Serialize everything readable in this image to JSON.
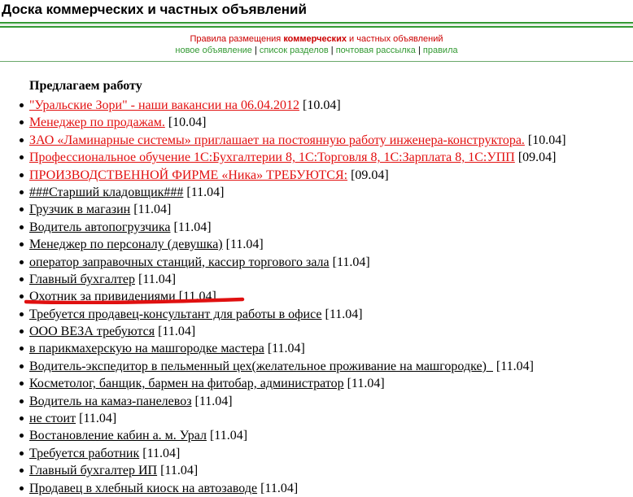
{
  "page": {
    "site_title": "Доска коммерческих и частных объявлений"
  },
  "header": {
    "rules_prefix": "Правила размещения",
    "rules_commercial": "коммерческих",
    "rules_and_private": "и частных объявлений",
    "nav": [
      {
        "label": "новое объявление"
      },
      {
        "label": "список разделов"
      },
      {
        "label": "почтовая рассылка"
      },
      {
        "label": "правила"
      }
    ],
    "separator": " | "
  },
  "section": {
    "heading": "Предлагаем работу"
  },
  "ads": [
    {
      "title": "\"Уральские Зори\" - наши вакансии на 06.04.2012",
      "date": "[10.04]",
      "highlight": true
    },
    {
      "title": "Менеджер по продажам.",
      "date": "[10.04]",
      "highlight": true
    },
    {
      "title": "ЗАО «Ламинарные системы» приглашает на постоянную работу инженера-конструктора.",
      "date": "[10.04]",
      "highlight": true
    },
    {
      "title": "Профессиональное обучение 1С:Бухгалтерии 8, 1С:Торговля 8, 1С:Зарплата 8, 1С:УПП",
      "date": "[09.04]",
      "highlight": true
    },
    {
      "title": "ПРОИЗВОДСТВЕННОЙ ФИРМЕ «Ника» ТРЕБУЮТСЯ:",
      "date": "[09.04]",
      "highlight": true
    },
    {
      "title": "###Старший кладовщик###",
      "date": "[11.04]",
      "highlight": false
    },
    {
      "title": "Грузчик в магазин",
      "date": "[11.04]",
      "highlight": false
    },
    {
      "title": "Водитель автопогрузчика",
      "date": "[11.04]",
      "highlight": false
    },
    {
      "title": "Менеджер по персоналу (девушка)",
      "date": "[11.04]",
      "highlight": false
    },
    {
      "title": "оператор заправочных станций, кассир торгового зала",
      "date": "[11.04]",
      "highlight": false
    },
    {
      "title": "Главный бухгалтер",
      "date": "[11.04]",
      "highlight": false
    },
    {
      "title": "Охотник за привидениями",
      "date": "[11.04]",
      "highlight": false
    },
    {
      "title": "Требуется продавец-консультант для работы в офисе",
      "date": "[11.04]",
      "highlight": false
    },
    {
      "title": "ООО ВЕЗА требуются",
      "date": "[11.04]",
      "highlight": false
    },
    {
      "title": "в парикмахерскую на машгородке мастера",
      "date": "[11.04]",
      "highlight": false
    },
    {
      "title": "Водитель-экспедитор в пельменный цех(желательное проживание на машгородке)_",
      "date": "[11.04]",
      "highlight": false
    },
    {
      "title": "Косметолог, банщик, бармен на фитобар, администратор",
      "date": "[11.04]",
      "highlight": false
    },
    {
      "title": "Водитель на камаз-панелевоз",
      "date": "[11.04]",
      "highlight": false
    },
    {
      "title": "не стоит",
      "date": "[11.04]",
      "highlight": false
    },
    {
      "title": "Востановление кабин а. м. Урал",
      "date": "[11.04]",
      "highlight": false
    },
    {
      "title": "Требуется работник",
      "date": "[11.04]",
      "highlight": false
    },
    {
      "title": "Главный бухгалтер ИП",
      "date": "[11.04]",
      "highlight": false
    },
    {
      "title": "Продавец в хлебный киоск на автозаводе",
      "date": "[11.04]",
      "highlight": false
    }
  ],
  "colors": {
    "accent_green": "#339933",
    "highlight_red": "#e21010",
    "annotation_red": "#e01010"
  }
}
